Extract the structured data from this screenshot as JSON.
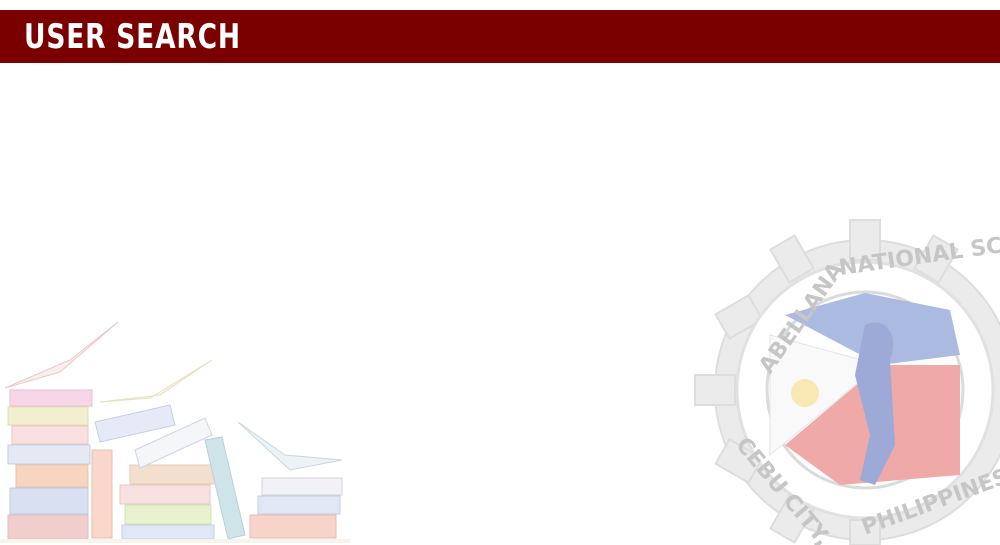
{
  "header": {
    "title": "USER SEARCH",
    "background_color": "#7a0000"
  },
  "watermark_books": {
    "icon": "stack-of-books-illustration"
  },
  "watermark_seal": {
    "icon": "school-seal-gear-logo",
    "text_top": "ABELLANA NATIONAL SC",
    "text_bottom": "CEBU CITY, PHILIPPINES"
  }
}
